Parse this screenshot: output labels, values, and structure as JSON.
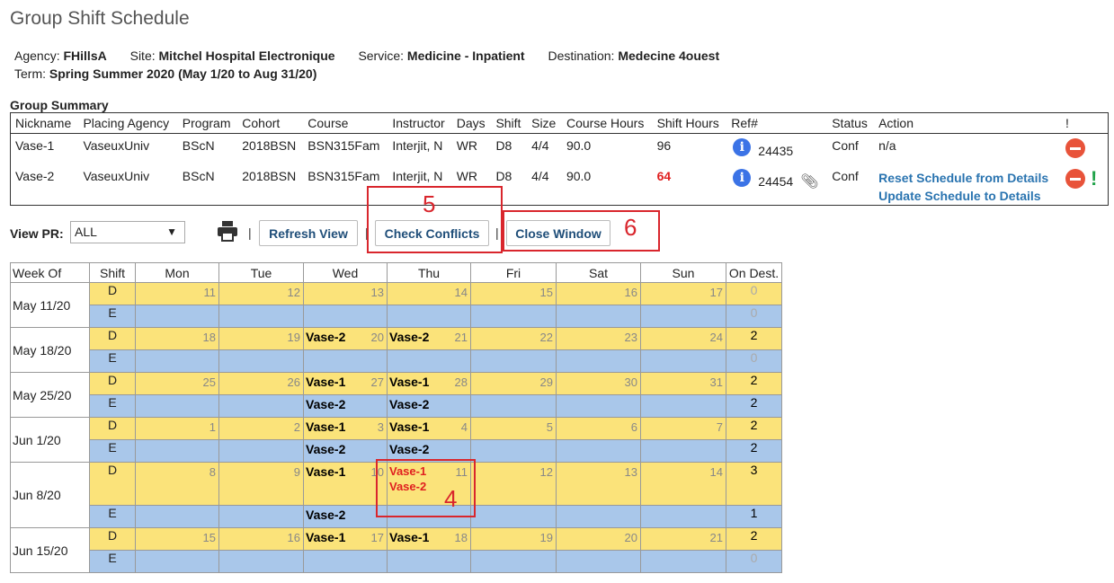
{
  "page": {
    "title": "Group Shift Schedule",
    "agency_label": "Agency:",
    "agency": "FHillsA",
    "site_label": "Site:",
    "site": "Mitchel Hospital Electronique",
    "service_label": "Service:",
    "service": "Medicine - Inpatient",
    "destination_label": "Destination:",
    "destination": "Medecine 4ouest",
    "term_label": "Term:",
    "term": "Spring Summer 2020",
    "term_dates": "(May 1/20 to Aug 31/20)"
  },
  "summary": {
    "label": "Group Summary",
    "headers": [
      "Nickname",
      "Placing Agency",
      "Program",
      "Cohort",
      "Course",
      "Instructor",
      "Days",
      "Shift",
      "Size",
      "Course Hours",
      "Shift Hours",
      "Ref#",
      "Status",
      "Action",
      "!"
    ],
    "rows": [
      {
        "nickname": "Vase-1",
        "agency": "VaseuxUniv",
        "program": "BScN",
        "cohort": "2018BSN",
        "course": "BSN315Fam",
        "instructor": "Interjit, N",
        "days": "WR",
        "shift": "D8",
        "size": "4/4",
        "course_hours": "90.0",
        "shift_hours": "96",
        "ref": "24435",
        "status": "Conf",
        "action": "n/a"
      },
      {
        "nickname": "Vase-2",
        "agency": "VaseuxUniv",
        "program": "BScN",
        "cohort": "2018BSN",
        "course": "BSN315Fam",
        "instructor": "Interjit, N",
        "days": "WR",
        "shift": "D8",
        "size": "4/4",
        "course_hours": "90.0",
        "shift_hours": "64",
        "ref": "24454",
        "status": "Conf",
        "action1": "Reset Schedule from Details",
        "action2": "Update Schedule to Details"
      }
    ]
  },
  "toolbar": {
    "view_label": "View PR:",
    "view_value": "ALL",
    "sep": "|",
    "refresh": "Refresh View",
    "check": "Check Conflicts",
    "close": "Close Window"
  },
  "annotations": {
    "a4": "4",
    "a5": "5",
    "a6": "6"
  },
  "grid": {
    "headers": [
      "Week Of",
      "Shift",
      "Mon",
      "Tue",
      "Wed",
      "Thu",
      "Fri",
      "Sat",
      "Sun",
      "On Dest."
    ],
    "shift_d": "D",
    "shift_e": "E",
    "weeks": [
      {
        "label": "May 11/20",
        "days": [
          "11",
          "12",
          "13",
          "14",
          "15",
          "16",
          "17"
        ],
        "d": [
          "",
          "",
          "",
          "",
          "",
          "",
          ""
        ],
        "d2": [
          "",
          "",
          "",
          "",
          "",
          "",
          ""
        ],
        "e": [
          "",
          "",
          "",
          "",
          "",
          "",
          ""
        ],
        "dd": "0",
        "de": "0"
      },
      {
        "label": "May 18/20",
        "days": [
          "18",
          "19",
          "20",
          "21",
          "22",
          "23",
          "24"
        ],
        "d": [
          "",
          "",
          "Vase-2",
          "Vase-2",
          "",
          "",
          ""
        ],
        "d2": [
          "",
          "",
          "",
          "",
          "",
          "",
          ""
        ],
        "e": [
          "",
          "",
          "",
          "",
          "",
          "",
          ""
        ],
        "dd": "2",
        "de": "0"
      },
      {
        "label": "May 25/20",
        "days": [
          "25",
          "26",
          "27",
          "28",
          "29",
          "30",
          "31"
        ],
        "d": [
          "",
          "",
          "Vase-1",
          "Vase-1",
          "",
          "",
          ""
        ],
        "d2": [
          "",
          "",
          "",
          "",
          "",
          "",
          ""
        ],
        "e": [
          "",
          "",
          "Vase-2",
          "Vase-2",
          "",
          "",
          ""
        ],
        "dd": "2",
        "de": "2"
      },
      {
        "label": "Jun 1/20",
        "days": [
          "1",
          "2",
          "3",
          "4",
          "5",
          "6",
          "7"
        ],
        "d": [
          "",
          "",
          "Vase-1",
          "Vase-1",
          "",
          "",
          ""
        ],
        "d2": [
          "",
          "",
          "",
          "",
          "",
          "",
          ""
        ],
        "e": [
          "",
          "",
          "Vase-2",
          "Vase-2",
          "",
          "",
          ""
        ],
        "dd": "2",
        "de": "2"
      },
      {
        "label": "Jun 8/20",
        "days": [
          "8",
          "9",
          "10",
          "11",
          "12",
          "13",
          "14"
        ],
        "d": [
          "",
          "",
          "Vase-1",
          "Vase-1",
          "",
          "",
          ""
        ],
        "d2": [
          "",
          "",
          "",
          "Vase-2",
          "",
          "",
          ""
        ],
        "e": [
          "",
          "",
          "Vase-2",
          "",
          "",
          "",
          ""
        ],
        "dd": "3",
        "de": "1"
      },
      {
        "label": "Jun 15/20",
        "days": [
          "15",
          "16",
          "17",
          "18",
          "19",
          "20",
          "21"
        ],
        "d": [
          "",
          "",
          "Vase-1",
          "Vase-1",
          "",
          "",
          ""
        ],
        "d2": [
          "",
          "",
          "",
          "",
          "",
          "",
          ""
        ],
        "e": [
          "",
          "",
          "",
          "",
          "",
          "",
          ""
        ],
        "dd": "2",
        "de": "0"
      }
    ]
  }
}
